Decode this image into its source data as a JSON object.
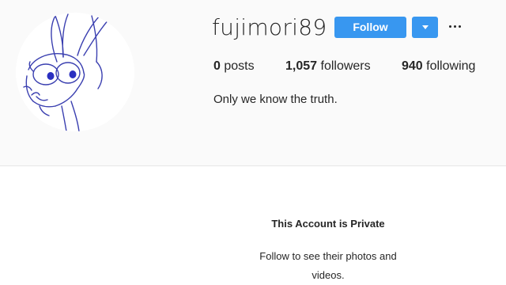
{
  "profile": {
    "username": "fujimori89",
    "follow_label": "Follow",
    "bio": "Only we know the truth.",
    "avatar_icon": "cartoon-rabbit-sketch"
  },
  "stats": {
    "posts_count": "0",
    "posts_label": "posts",
    "followers_count": "1,057",
    "followers_label": "followers",
    "following_count": "940",
    "following_label": "following"
  },
  "private_notice": {
    "title": "This Account is Private",
    "subtitle": "Follow to see their photos and videos."
  },
  "colors": {
    "accent": "#3897f0",
    "header_bg": "#fafafa",
    "text": "#262626",
    "sketch": "#3a3fb0"
  }
}
